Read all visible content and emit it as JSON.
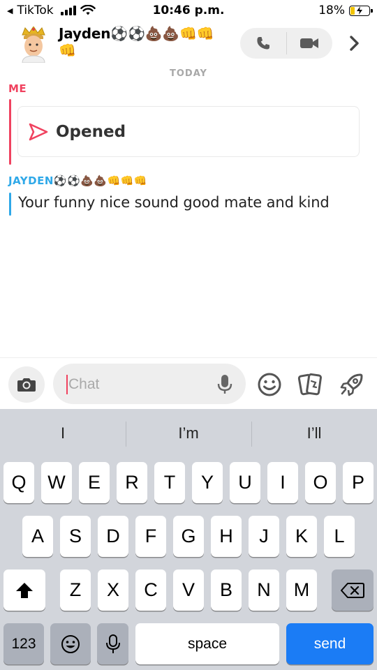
{
  "status_bar": {
    "back_app": "TikTok",
    "time": "10:46 p.m.",
    "battery": "18%",
    "battery_level": 0.18
  },
  "header": {
    "name": "Jayden⚽⚽💩💩👊👊👊"
  },
  "messages": {
    "date_separator": "TODAY",
    "me_label": "ME",
    "opened_text": "Opened",
    "friend_label": "JAYDEN⚽⚽💩💩👊👊👊",
    "friend_message": "Your funny nice sound good mate and kind"
  },
  "input": {
    "placeholder": "Chat"
  },
  "keyboard": {
    "suggestions": [
      "I",
      "I’m",
      "I’ll"
    ],
    "row1": [
      "Q",
      "W",
      "E",
      "R",
      "T",
      "Y",
      "U",
      "I",
      "O",
      "P"
    ],
    "row2": [
      "A",
      "S",
      "D",
      "F",
      "G",
      "H",
      "J",
      "K",
      "L"
    ],
    "row3": [
      "Z",
      "X",
      "C",
      "V",
      "B",
      "N",
      "M"
    ],
    "numbers_label": "123",
    "space_label": "space",
    "send_label": "send"
  },
  "colors": {
    "me_red": "#f0425f",
    "friend_blue": "#2ea8e8",
    "send_blue": "#1b7cf5"
  }
}
